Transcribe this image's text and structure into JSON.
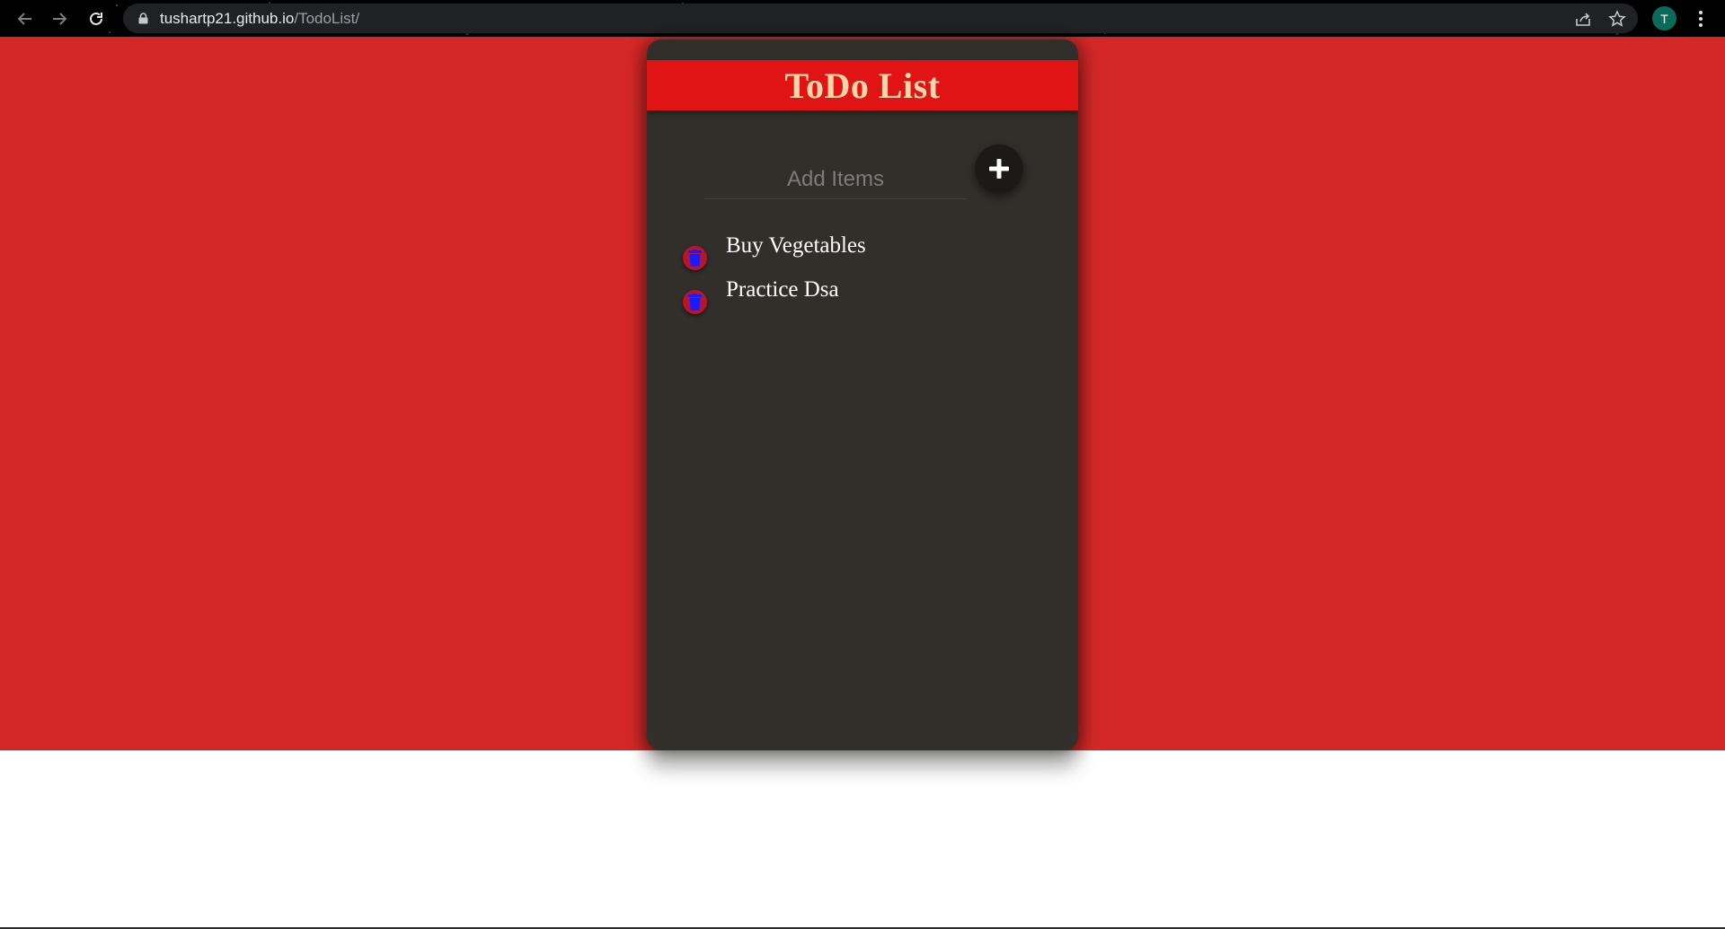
{
  "browser": {
    "url_host": "tushartp21.github.io",
    "url_path": "/TodoList/",
    "avatar_letter": "T"
  },
  "app": {
    "title": "ToDo List",
    "input_placeholder": "Add Items",
    "add_button_icon": "plus-icon",
    "delete_button_icon": "trash-icon",
    "items": [
      {
        "text": "Buy Vegetables"
      },
      {
        "text": "Practice Dsa"
      }
    ]
  },
  "colors": {
    "page_background": "#d42828",
    "card_background": "#302f2a",
    "header_background": "#e01414",
    "title_color": "#f6d6a8",
    "delete_button": "#b8142a",
    "trash_fill": "#1a1aff"
  }
}
